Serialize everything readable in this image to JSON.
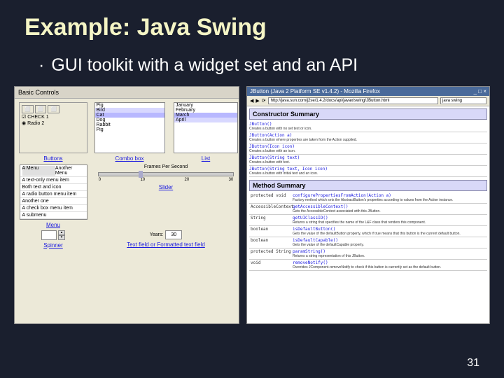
{
  "slide": {
    "title": "Example: Java Swing",
    "bullet": "GUI toolkit with a widget set and an API",
    "page_number": "31"
  },
  "widgets": {
    "tab": "Basic Controls",
    "buttons": {
      "label": "Buttons",
      "check1": "CHECK 1",
      "radio1": "Radio 2"
    },
    "combo": {
      "label": "Combo box",
      "items": [
        "Pig",
        "Bird",
        "Cat",
        "Dog",
        "Rabbit",
        "Pig"
      ]
    },
    "list": {
      "label": "List",
      "items": [
        "January",
        "February",
        "March",
        "April"
      ]
    },
    "menu": {
      "label": "Menu",
      "tab1": "A Menu",
      "tab2": "Another Menu",
      "items": [
        "A text-only menu item",
        "Both text and icon",
        "A radio button menu item",
        "Another one",
        "A check box menu item",
        "A submenu"
      ]
    },
    "slider": {
      "label": "Slider",
      "title": "Frames Per Second",
      "ticks": [
        "0",
        "10",
        "20",
        "30"
      ]
    },
    "spinner": {
      "label": "Spinner"
    },
    "textfield": {
      "label": "Text field or Formatted text field",
      "lab": "Years:",
      "val": "30"
    }
  },
  "browser": {
    "title": "JButton (Java 2 Platform SE v1.4.2) - Mozilla Firefox",
    "address": "http://java.sun.com/j2se/1.4.2/docs/api/javax/swing/JButton.html",
    "search": "java swing",
    "section1": "Constructor Summary",
    "section2": "Method Summary",
    "constructors": [
      {
        "sig": "JButton()",
        "desc": "Creates a button with no set text or icon."
      },
      {
        "sig": "JButton(Action a)",
        "desc": "Creates a button where properties are taken from the Action supplied."
      },
      {
        "sig": "JButton(Icon icon)",
        "desc": "Creates a button with an icon."
      },
      {
        "sig": "JButton(String text)",
        "desc": "Creates a button with text."
      },
      {
        "sig": "JButton(String text, Icon icon)",
        "desc": "Creates a button with initial text and an icon."
      }
    ],
    "methods": [
      {
        "mod": "protected void",
        "sig": "configurePropertiesFromAction(Action a)",
        "desc": "Factory method which sets the AbstractButton's properties according to values from the Action instance."
      },
      {
        "mod": "AccessibleContext",
        "sig": "getAccessibleContext()",
        "desc": "Gets the AccessibleContext associated with this JButton."
      },
      {
        "mod": "String",
        "sig": "getUIClassID()",
        "desc": "Returns a string that specifies the name of the L&F class that renders this component."
      },
      {
        "mod": "boolean",
        "sig": "isDefaultButton()",
        "desc": "Gets the value of the defaultButton property, which if true means that this button is the current default button."
      },
      {
        "mod": "boolean",
        "sig": "isDefaultCapable()",
        "desc": "Gets the value of the defaultCapable property."
      },
      {
        "mod": "protected String",
        "sig": "paramString()",
        "desc": "Returns a string representation of this JButton."
      },
      {
        "mod": "void",
        "sig": "removeNotify()",
        "desc": "Overrides JComponent.removeNotify to check if this button is currently set as the default button."
      }
    ]
  }
}
